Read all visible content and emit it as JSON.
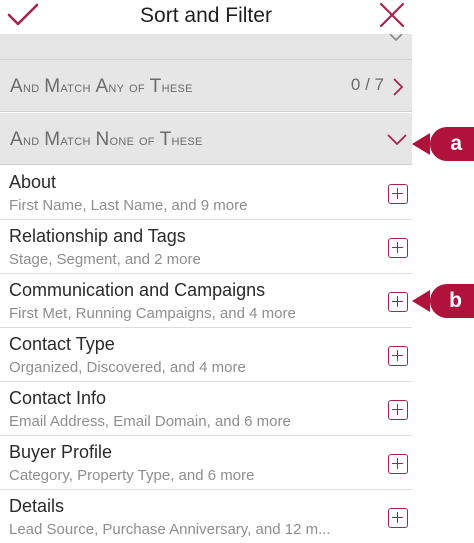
{
  "header": {
    "title": "Sort and Filter",
    "confirm_icon": "checkmark-icon",
    "close_icon": "close-icon"
  },
  "sections": [
    {
      "label_first": "A",
      "label_rest": "nd ",
      "label_m": "M",
      "label_m_rest": "atch ",
      "label_a": "A",
      "label_a_rest": "ny of ",
      "label_t": "T",
      "label_t_rest": "hese",
      "count": "0 / 7",
      "state": "collapsed"
    },
    {
      "label_first": "A",
      "label_rest": "nd ",
      "label_m": "M",
      "label_m_rest": "atch ",
      "label_a": "N",
      "label_a_rest": "one of ",
      "label_t": "T",
      "label_t_rest": "hese",
      "count": "",
      "state": "expanded"
    }
  ],
  "items": [
    {
      "name": "About",
      "sub": "First Name, Last Name, and 9 more"
    },
    {
      "name": "Relationship and Tags",
      "sub": "Stage, Segment, and 2 more"
    },
    {
      "name": "Communication and Campaigns",
      "sub": "First Met, Running Campaigns, and 4 more"
    },
    {
      "name": "Contact Type",
      "sub": "Organized, Discovered, and 4 more"
    },
    {
      "name": "Contact Info",
      "sub": "Email Address, Email Domain, and 6 more"
    },
    {
      "name": "Buyer Profile",
      "sub": "Category, Property Type, and 6 more"
    },
    {
      "name": "Details",
      "sub": "Lead Source, Purchase Anniversary, and 12 m..."
    }
  ],
  "callouts": {
    "a": "a",
    "b": "b"
  },
  "colors": {
    "accent": "#a7234f",
    "callout": "#b0123c",
    "section_bg": "#e6e6e6"
  }
}
